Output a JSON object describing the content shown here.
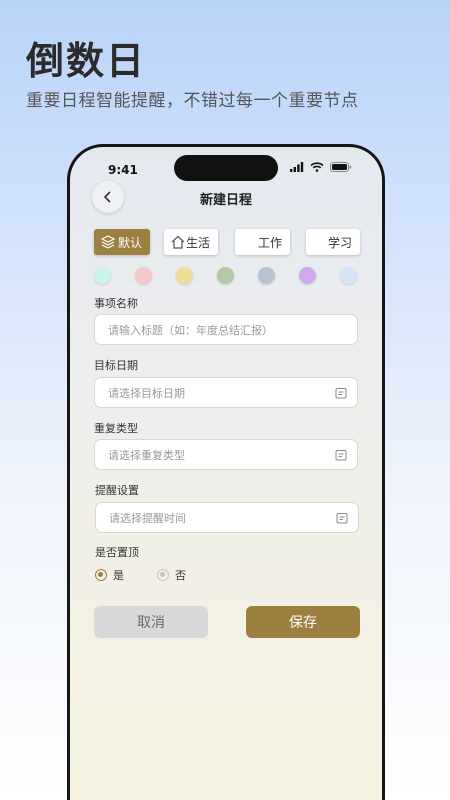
{
  "promo": {
    "title": "倒数日",
    "subtitle": "重要日程智能提醒，不错过每一个重要节点"
  },
  "status_bar": {
    "time": "9:41"
  },
  "header": {
    "title": "新建日程"
  },
  "categories": [
    {
      "label": "默认",
      "icon": "layers-icon",
      "active": true
    },
    {
      "label": "生活",
      "icon": "home-icon",
      "active": false
    },
    {
      "label": "工作",
      "icon": "",
      "active": false
    },
    {
      "label": "学习",
      "icon": "",
      "active": false
    }
  ],
  "colors": [
    "#c9f3e6",
    "#f7c8ca",
    "#eedd9a",
    "#b4c8a6",
    "#b7c3d1",
    "#cfa9ee",
    "#d4e3f8"
  ],
  "form": {
    "title_label": "事项名称",
    "title_placeholder": "请输入标题（如：年度总结汇报）",
    "date_label": "目标日期",
    "date_placeholder": "请选择目标日期",
    "repeat_label": "重复类型",
    "repeat_placeholder": "请选择重复类型",
    "remind_label": "提醒设置",
    "remind_placeholder": "请选择提醒时间",
    "pin_label": "是否置顶",
    "pin_options": [
      "是",
      "否"
    ],
    "pin_selected": "是"
  },
  "buttons": {
    "cancel": "取消",
    "save": "保存"
  },
  "accent_color": "#9c803f"
}
